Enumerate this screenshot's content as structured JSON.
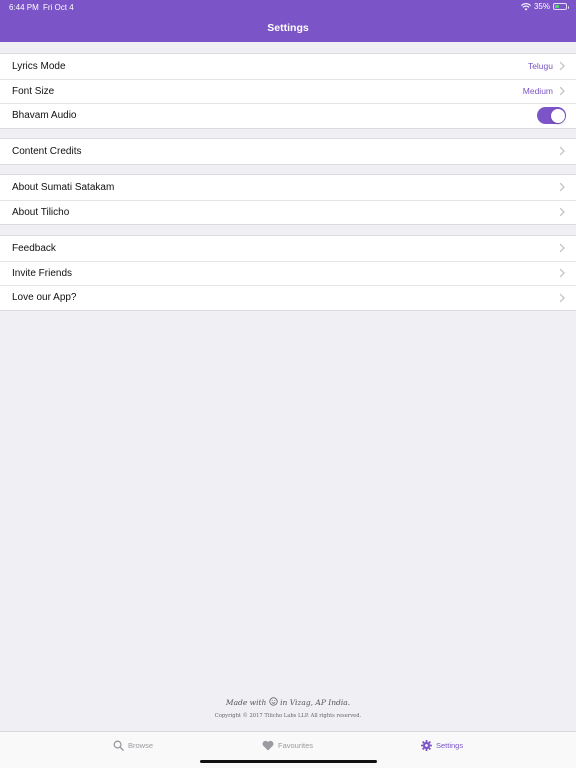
{
  "status_bar": {
    "time": "6:44 PM",
    "date": "Fri Oct 4",
    "battery": "35%",
    "battery_level": 0.35
  },
  "nav": {
    "title": "Settings"
  },
  "groups": [
    {
      "rows": [
        {
          "label": "Lyrics Mode",
          "value": "Telugu",
          "type": "disclosure"
        },
        {
          "label": "Font Size",
          "value": "Medium",
          "type": "disclosure"
        },
        {
          "label": "Bhavam Audio",
          "type": "toggle",
          "on": true
        }
      ]
    },
    {
      "rows": [
        {
          "label": "Content Credits",
          "type": "disclosure"
        }
      ]
    },
    {
      "rows": [
        {
          "label": "About Sumati Satakam",
          "type": "disclosure"
        },
        {
          "label": "About Tilicho",
          "type": "disclosure"
        }
      ]
    },
    {
      "rows": [
        {
          "label": "Feedback",
          "type": "disclosure"
        },
        {
          "label": "Invite Friends",
          "type": "disclosure"
        },
        {
          "label": "Love our App?",
          "type": "disclosure"
        }
      ]
    }
  ],
  "footer": {
    "made_with_prefix": "Made with",
    "made_with_suffix": "in Vizag, AP India.",
    "copyright": "Copyright © 2017 Tilicho Labs LLP. All rights reserved."
  },
  "tabs": [
    {
      "label": "Browse",
      "icon": "search-icon",
      "active": false
    },
    {
      "label": "Favourites",
      "icon": "heart-icon",
      "active": false
    },
    {
      "label": "Settings",
      "icon": "gear-icon",
      "active": true
    }
  ],
  "colors": {
    "accent": "#7b55c7",
    "background": "#efeff4",
    "inactive_tab": "#9a9aa0"
  }
}
